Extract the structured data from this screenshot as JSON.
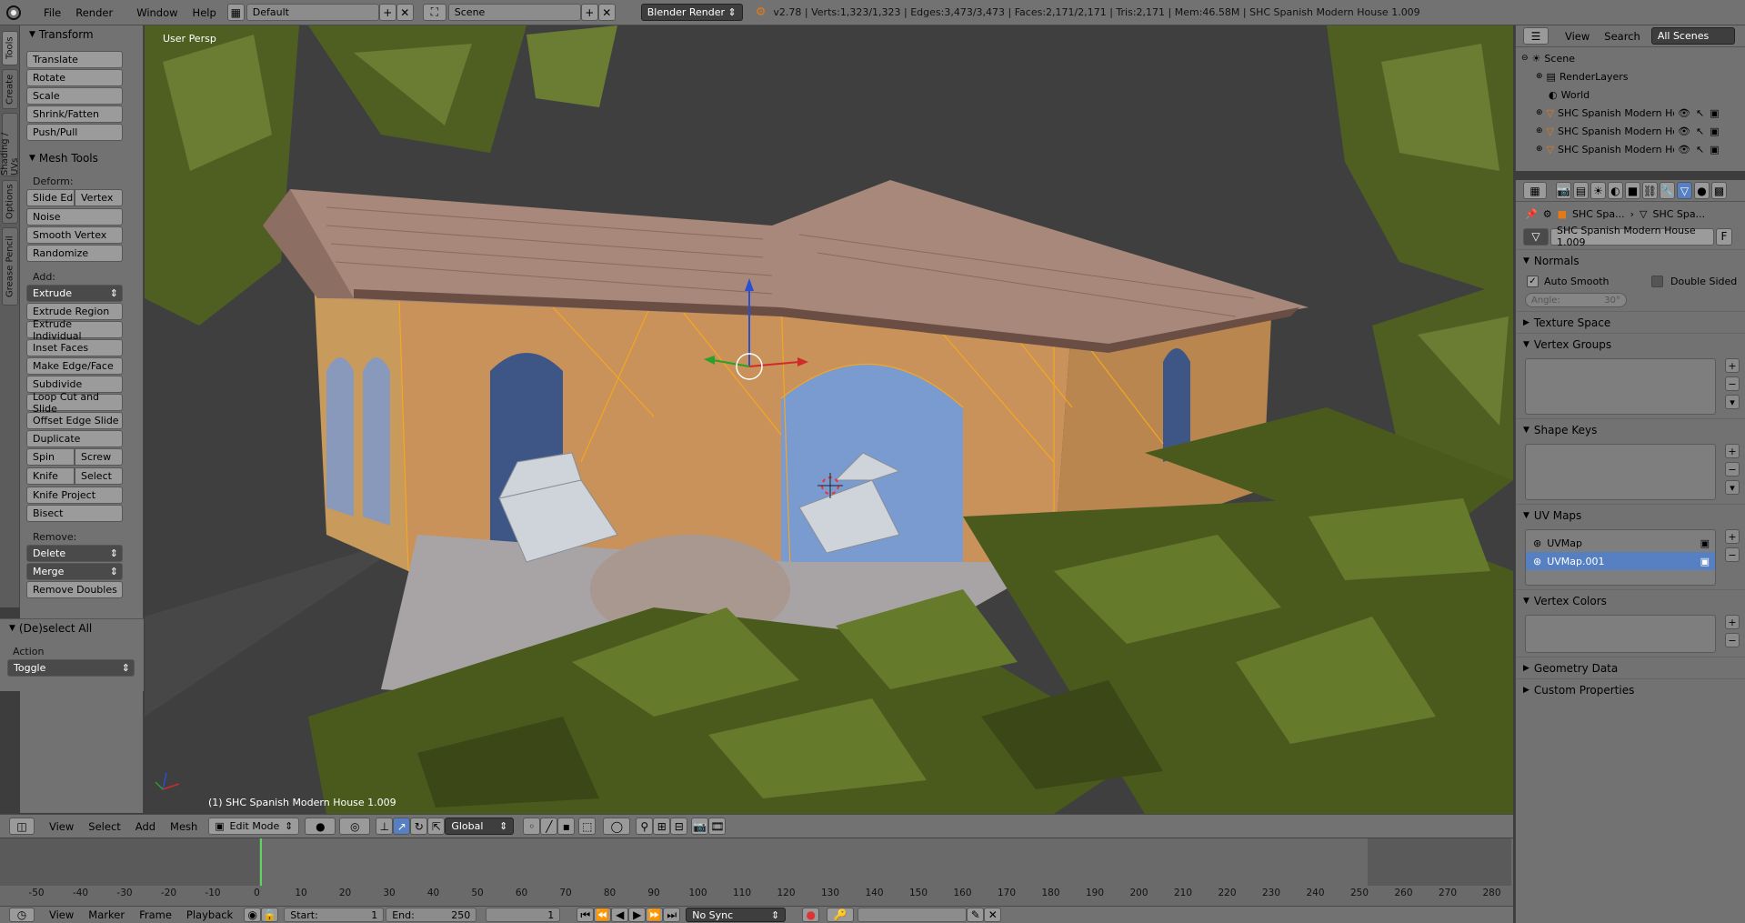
{
  "top": {
    "menus": [
      "File",
      "Render",
      "Window",
      "Help"
    ],
    "layout": "Default",
    "scene": "Scene",
    "engine": "Blender Render",
    "stats": "v2.78 | Verts:1,323/1,323 | Edges:3,473/3,473 | Faces:2,171/2,171 | Tris:2,171 | Mem:46.58M | SHC Spanish Modern House 1.009"
  },
  "tabs": [
    "Tools",
    "Create",
    "Shading / UVs",
    "Options",
    "Grease Pencil"
  ],
  "shelf": {
    "transform": {
      "title": "Transform",
      "items": [
        "Translate",
        "Rotate",
        "Scale",
        "Shrink/Fatten",
        "Push/Pull"
      ]
    },
    "mesh_tools": {
      "title": "Mesh Tools",
      "deform_label": "Deform:",
      "deform_row": [
        "Slide Ed",
        "Vertex"
      ],
      "deform": [
        "Noise",
        "Smooth Vertex",
        "Randomize"
      ],
      "add_label": "Add:",
      "extrude": "Extrude",
      "add": [
        "Extrude Region",
        "Extrude Individual",
        "Inset Faces",
        "Make Edge/Face",
        "Subdivide",
        "Loop Cut and Slide",
        "Offset Edge Slide",
        "Duplicate"
      ],
      "spin_row": [
        "Spin",
        "Screw"
      ],
      "knife_row": [
        "Knife",
        "Select"
      ],
      "add2": [
        "Knife Project",
        "Bisect"
      ],
      "remove_label": "Remove:",
      "delete": "Delete",
      "merge": "Merge",
      "remove_doubles": "Remove Doubles"
    },
    "operator": {
      "title": "(De)select All",
      "action_label": "Action",
      "action_value": "Toggle"
    }
  },
  "viewport": {
    "persp_label": "User Persp",
    "object_label": "(1) SHC Spanish Modern House 1.009"
  },
  "header3d": {
    "menus": [
      "View",
      "Select",
      "Add",
      "Mesh"
    ],
    "mode": "Edit Mode",
    "orientation": "Global"
  },
  "timeline": {
    "ticks": [
      "-50",
      "-40",
      "-30",
      "-20",
      "-10",
      "0",
      "10",
      "20",
      "30",
      "40",
      "50",
      "60",
      "70",
      "80",
      "90",
      "100",
      "110",
      "120",
      "130",
      "140",
      "150",
      "160",
      "170",
      "180",
      "190",
      "200",
      "210",
      "220",
      "230",
      "240",
      "250",
      "260",
      "270",
      "280"
    ],
    "menus": [
      "View",
      "Marker",
      "Frame",
      "Playback"
    ],
    "start_label": "Start:",
    "start": "1",
    "end_label": "End:",
    "end": "250",
    "current": "1",
    "sync": "No Sync"
  },
  "outliner": {
    "menus": [
      "View",
      "Search"
    ],
    "filter": "All Scenes",
    "rows": [
      {
        "label": "Scene",
        "indent": 0
      },
      {
        "label": "RenderLayers",
        "indent": 1
      },
      {
        "label": "World",
        "indent": 1
      },
      {
        "label": "SHC Spanish Modern Ho",
        "indent": 1
      },
      {
        "label": "SHC Spanish Modern Ho",
        "indent": 1
      },
      {
        "label": "SHC Spanish Modern Ho",
        "indent": 1
      }
    ]
  },
  "props": {
    "breadcrumb": [
      "SHC Spa...",
      "SHC Spa..."
    ],
    "mesh_name": "SHC Spanish Modern House 1.009",
    "fake_user": "F",
    "normals": {
      "title": "Normals",
      "auto_smooth": "Auto Smooth",
      "double_sided": "Double Sided",
      "angle": "Angle:",
      "angle_value": "30°"
    },
    "texture_space": "Texture Space",
    "vertex_groups": "Vertex Groups",
    "shape_keys": "Shape Keys",
    "uv_maps": {
      "title": "UV Maps",
      "items": [
        "UVMap",
        "UVMap.001"
      ],
      "selected": 1
    },
    "vertex_colors": "Vertex Colors",
    "geometry_data": "Geometry Data",
    "custom_properties": "Custom Properties"
  },
  "colors": {
    "accent": "#5680c2",
    "panel": "#727272",
    "viewport": "#3d3d3d",
    "selected_edge": "#f5a623"
  }
}
